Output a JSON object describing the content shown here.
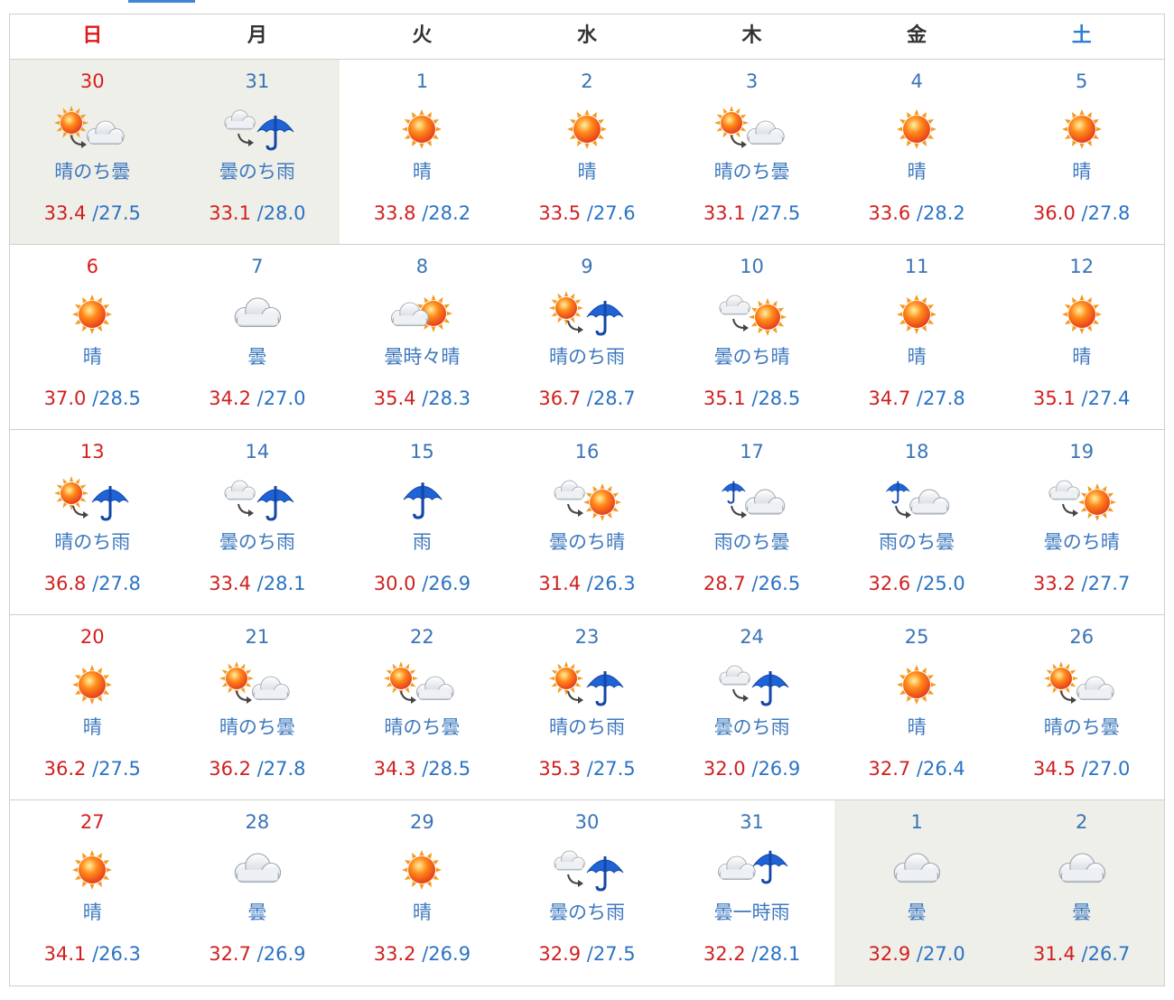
{
  "weekdays": [
    {
      "label": "日",
      "kind": "sun"
    },
    {
      "label": "月",
      "kind": ""
    },
    {
      "label": "火",
      "kind": ""
    },
    {
      "label": "水",
      "kind": ""
    },
    {
      "label": "木",
      "kind": ""
    },
    {
      "label": "金",
      "kind": ""
    },
    {
      "label": "土",
      "kind": "sat"
    }
  ],
  "days": [
    {
      "day": "30",
      "desc": "晴のち曇",
      "icon": "sun-then-cloud",
      "high": "33.4",
      "low": "27.5",
      "other": true
    },
    {
      "day": "31",
      "desc": "曇のち雨",
      "icon": "cloud-then-rain",
      "high": "33.1",
      "low": "28.0",
      "other": true
    },
    {
      "day": "1",
      "desc": "晴",
      "icon": "sun",
      "high": "33.8",
      "low": "28.2"
    },
    {
      "day": "2",
      "desc": "晴",
      "icon": "sun",
      "high": "33.5",
      "low": "27.6"
    },
    {
      "day": "3",
      "desc": "晴のち曇",
      "icon": "sun-then-cloud",
      "high": "33.1",
      "low": "27.5"
    },
    {
      "day": "4",
      "desc": "晴",
      "icon": "sun",
      "high": "33.6",
      "low": "28.2"
    },
    {
      "day": "5",
      "desc": "晴",
      "icon": "sun",
      "high": "36.0",
      "low": "27.8"
    },
    {
      "day": "6",
      "desc": "晴",
      "icon": "sun",
      "high": "37.0",
      "low": "28.5"
    },
    {
      "day": "7",
      "desc": "曇",
      "icon": "cloud",
      "high": "34.2",
      "low": "27.0"
    },
    {
      "day": "8",
      "desc": "曇時々晴",
      "icon": "cloud-sometimes-sun",
      "high": "35.4",
      "low": "28.3"
    },
    {
      "day": "9",
      "desc": "晴のち雨",
      "icon": "sun-then-rain",
      "high": "36.7",
      "low": "28.7"
    },
    {
      "day": "10",
      "desc": "曇のち晴",
      "icon": "cloud-then-sun",
      "high": "35.1",
      "low": "28.5"
    },
    {
      "day": "11",
      "desc": "晴",
      "icon": "sun",
      "high": "34.7",
      "low": "27.8"
    },
    {
      "day": "12",
      "desc": "晴",
      "icon": "sun",
      "high": "35.1",
      "low": "27.4"
    },
    {
      "day": "13",
      "desc": "晴のち雨",
      "icon": "sun-then-rain",
      "high": "36.8",
      "low": "27.8"
    },
    {
      "day": "14",
      "desc": "曇のち雨",
      "icon": "cloud-then-rain",
      "high": "33.4",
      "low": "28.1"
    },
    {
      "day": "15",
      "desc": "雨",
      "icon": "rain",
      "high": "30.0",
      "low": "26.9"
    },
    {
      "day": "16",
      "desc": "曇のち晴",
      "icon": "cloud-then-sun",
      "high": "31.4",
      "low": "26.3"
    },
    {
      "day": "17",
      "desc": "雨のち曇",
      "icon": "rain-then-cloud",
      "high": "28.7",
      "low": "26.5"
    },
    {
      "day": "18",
      "desc": "雨のち曇",
      "icon": "rain-then-cloud",
      "high": "32.6",
      "low": "25.0"
    },
    {
      "day": "19",
      "desc": "曇のち晴",
      "icon": "cloud-then-sun",
      "high": "33.2",
      "low": "27.7"
    },
    {
      "day": "20",
      "desc": "晴",
      "icon": "sun",
      "high": "36.2",
      "low": "27.5"
    },
    {
      "day": "21",
      "desc": "晴のち曇",
      "icon": "sun-then-cloud",
      "high": "36.2",
      "low": "27.8"
    },
    {
      "day": "22",
      "desc": "晴のち曇",
      "icon": "sun-then-cloud",
      "high": "34.3",
      "low": "28.5"
    },
    {
      "day": "23",
      "desc": "晴のち雨",
      "icon": "sun-then-rain",
      "high": "35.3",
      "low": "27.5"
    },
    {
      "day": "24",
      "desc": "曇のち雨",
      "icon": "cloud-then-rain",
      "high": "32.0",
      "low": "26.9"
    },
    {
      "day": "25",
      "desc": "晴",
      "icon": "sun",
      "high": "32.7",
      "low": "26.4"
    },
    {
      "day": "26",
      "desc": "晴のち曇",
      "icon": "sun-then-cloud",
      "high": "34.5",
      "low": "27.0"
    },
    {
      "day": "27",
      "desc": "晴",
      "icon": "sun",
      "high": "34.1",
      "low": "26.3"
    },
    {
      "day": "28",
      "desc": "曇",
      "icon": "cloud",
      "high": "32.7",
      "low": "26.9"
    },
    {
      "day": "29",
      "desc": "晴",
      "icon": "sun",
      "high": "33.2",
      "low": "26.9"
    },
    {
      "day": "30",
      "desc": "曇のち雨",
      "icon": "cloud-then-rain",
      "high": "32.9",
      "low": "27.5"
    },
    {
      "day": "31",
      "desc": "曇一時雨",
      "icon": "cloud-occasional-rain",
      "high": "32.2",
      "low": "28.1"
    },
    {
      "day": "1",
      "desc": "曇",
      "icon": "cloud",
      "high": "32.9",
      "low": "27.0",
      "other": true
    },
    {
      "day": "2",
      "desc": "曇",
      "icon": "cloud",
      "high": "31.4",
      "low": "26.7",
      "other": true
    }
  ],
  "colors": {
    "high": "#d01f1f",
    "low": "#2a73c4",
    "sunday": "#d81e1e",
    "saturday": "#2a7fd4",
    "accent": "#3f86d6",
    "other_month_bg": "#efefe9"
  }
}
